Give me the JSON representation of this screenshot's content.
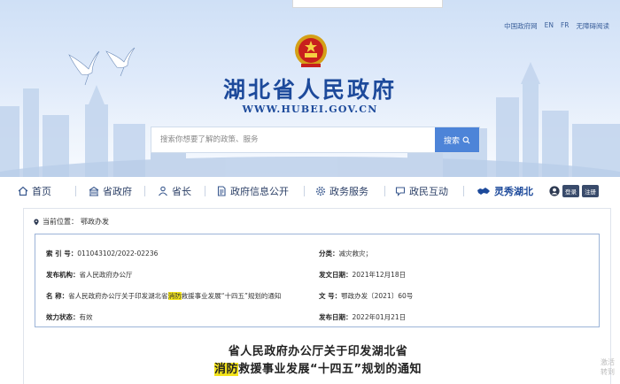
{
  "header": {
    "top_links": [
      "中国政府网",
      "EN",
      "FR",
      "无障碍阅读"
    ],
    "site_title": "湖北省人民政府",
    "site_url": "WWW.HUBEI.GOV.CN",
    "search": {
      "placeholder": "搜索你想要了解的政策、服务",
      "button_label": "搜索"
    }
  },
  "nav": {
    "items": [
      {
        "label": "首页",
        "icon": "home-icon"
      },
      {
        "label": "省政府",
        "icon": "building-icon"
      },
      {
        "label": "省长",
        "icon": "person-icon"
      },
      {
        "label": "政府信息公开",
        "icon": "document-icon"
      },
      {
        "label": "政务服务",
        "icon": "gear-icon"
      },
      {
        "label": "政民互动",
        "icon": "chat-icon"
      },
      {
        "label": "灵秀湖北",
        "icon": "hubei-map-icon"
      }
    ],
    "login_label": "登录",
    "register_label": "注册"
  },
  "breadcrumb": {
    "prefix": "当前位置：",
    "current": "鄂政办发"
  },
  "meta": {
    "index_no": {
      "label": "索 引 号：",
      "value": "011043102/2022-02236"
    },
    "category": {
      "label": "分类：",
      "value": "减灾救灾；"
    },
    "issuer": {
      "label": "发布机构：",
      "value": "省人民政府办公厅"
    },
    "issue_date": {
      "label": "发文日期：",
      "value": "2021年12月18日"
    },
    "name": {
      "label": "名      称：",
      "value_pre": "省人民政府办公厅关于印发湖北省",
      "value_highlight": "消防",
      "value_post": "救援事业发展“十四五”规划的通知"
    },
    "doc_no": {
      "label": "文      号：",
      "value": "鄂政办发〔2021〕60号"
    },
    "status": {
      "label": "效力状态：",
      "value": "有效"
    },
    "publish_date": {
      "label": "发布日期：",
      "value": "2022年01月21日"
    }
  },
  "document": {
    "title_line1": "省人民政府办公厅关于印发湖北省",
    "title_line2_highlight": "消防",
    "title_line2_rest": "救援事业发展“十四五”规划的通知"
  },
  "watermark": {
    "line1": "激活",
    "line2": "转到"
  },
  "colors": {
    "brand_blue": "#1d4a9b",
    "search_button": "#4d84d8",
    "highlight": "#f5e51b",
    "info_border": "#9cb4d8"
  }
}
